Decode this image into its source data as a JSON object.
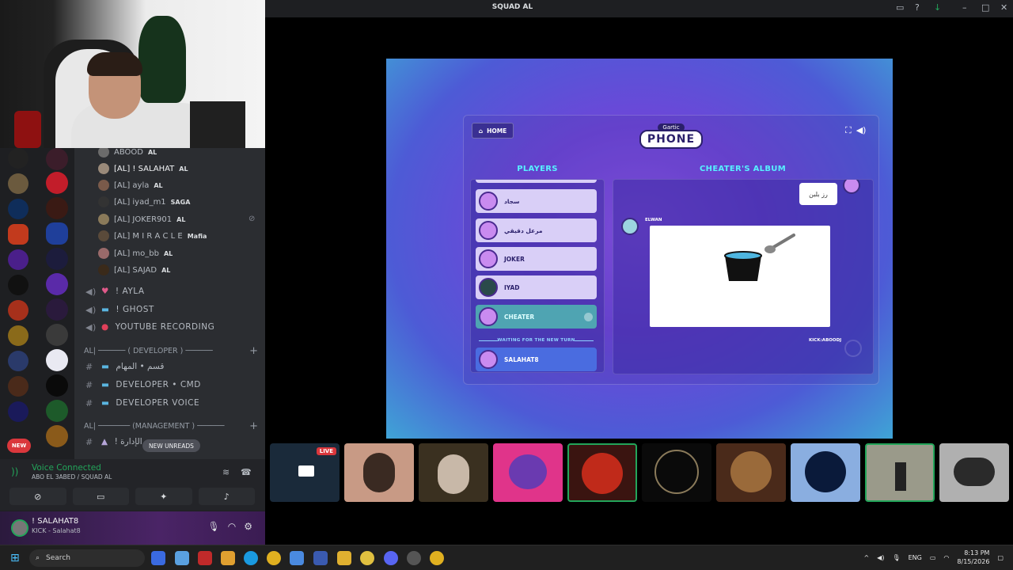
{
  "window": {
    "title": "SQUAD AL"
  },
  "voice_users": [
    {
      "name": "ABOOD",
      "badge": "AL"
    },
    {
      "name": "[AL] ! SALAHAT",
      "badge": "AL",
      "me": true
    },
    {
      "name": "[AL] ayla",
      "badge": "AL"
    },
    {
      "name": "[AL] iyad_m1",
      "badge": "SAGA"
    },
    {
      "name": "[AL] JOKER901",
      "badge": "AL"
    },
    {
      "name": "[AL] M I R A C L E",
      "badge": "Mafia"
    },
    {
      "name": "[AL] mo_bb",
      "badge": "AL"
    },
    {
      "name": "[AL] SAJAD",
      "badge": "AL"
    }
  ],
  "voice_channels": [
    "! AYLA",
    "! GHOST",
    "YOUTUBE RECORDING"
  ],
  "categories": {
    "developer": "AL| ────── ( DEVELOPER ) ──────",
    "management": "AL| ─────── (MANAGEMENT ) ──────"
  },
  "text_channels": [
    "قسم • المهام",
    "DEVELOPER • CMD",
    "DEVELOPER VOICE",
    "! الإدارة"
  ],
  "new_unreads": "NEW UNREADS",
  "new_badge": "NEW",
  "voice_panel": {
    "status": "Voice Connected",
    "location": "ABO EL 3ABED / SQUAD AL"
  },
  "user_panel": {
    "name": "! SALAHAT8",
    "status": "KICK - Salahat8"
  },
  "game": {
    "home": "HOME",
    "logo_top": "Gartic",
    "logo_main": "PHONE",
    "players_header": "PLAYERS",
    "album_header": "CHEATER'S ALBUM",
    "players": [
      {
        "name": "سجاد"
      },
      {
        "name": "مرعل دقيقي"
      },
      {
        "name": "JOKER"
      },
      {
        "name": "IYAD"
      },
      {
        "name": "CHEATER"
      }
    ],
    "waiting_label": "WAITING FOR THE NEW TURN",
    "waiting_player": "SALAHAT8",
    "bubble_text": "رز بلبن",
    "drawing_author": "ELWAN",
    "kick_label": "KICK:ABOODJ"
  },
  "stream_tiles": [
    {
      "live": "LIVE"
    }
  ],
  "taskbar": {
    "search": "Search",
    "lang": "ENG",
    "time": "8:13 PM",
    "date": "8/15/2026"
  }
}
